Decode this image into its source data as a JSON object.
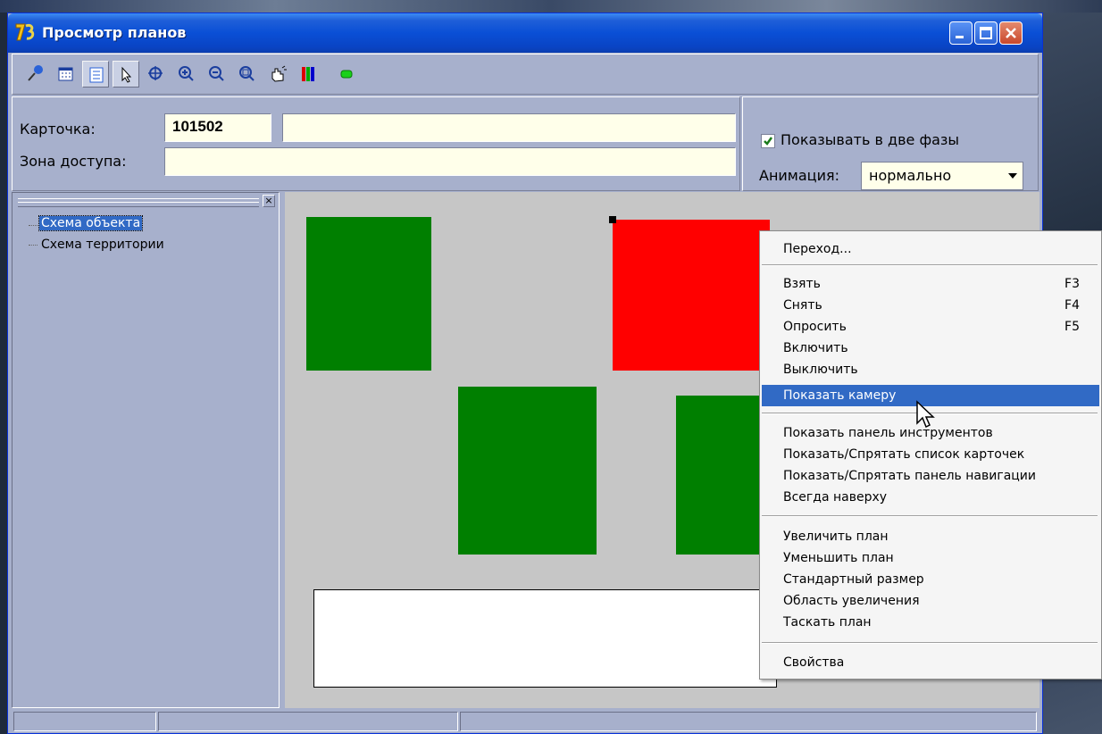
{
  "window": {
    "title": "Просмотр планов",
    "controls": [
      "minimize",
      "maximize",
      "close"
    ]
  },
  "toolbar": {
    "buttons": [
      {
        "icon": "pin-icon"
      },
      {
        "icon": "card-list-icon"
      },
      {
        "icon": "tree-panel-icon",
        "pressed": true
      },
      {
        "icon": "arrow-cursor-icon",
        "pressed": true
      },
      {
        "icon": "standard-size-icon"
      },
      {
        "icon": "zoom-in-icon"
      },
      {
        "icon": "zoom-out-icon"
      },
      {
        "icon": "zoom-area-icon"
      },
      {
        "icon": "pan-hand-icon"
      },
      {
        "icon": "colors-icon"
      },
      {
        "icon": "status-indicator-icon"
      }
    ]
  },
  "info": {
    "card_label": "Карточка:",
    "card_number": "101502",
    "card_name": "",
    "zone_label": "Зона доступа:",
    "zone_value": ""
  },
  "options": {
    "two_phase_label": "Показывать в две фазы",
    "two_phase_checked": true,
    "animation_label": "Анимация:",
    "animation_value": "нормально"
  },
  "tree": {
    "items": [
      {
        "label": "Схема объекта",
        "selected": true
      },
      {
        "label": "Схема территории",
        "selected": false
      }
    ]
  },
  "plan": {
    "colors": {
      "ok": "#007f00",
      "alarm": "#ff0000"
    },
    "zones": [
      {
        "state": "ok"
      },
      {
        "state": "alarm",
        "selected": true
      },
      {
        "state": "ok"
      },
      {
        "state": "ok"
      }
    ]
  },
  "context_menu": {
    "highlighted": "Показать камеру",
    "groups": [
      [
        {
          "label": "Переход..."
        }
      ],
      [
        {
          "label": "Взять",
          "shortcut": "F3"
        },
        {
          "label": "Снять",
          "shortcut": "F4"
        },
        {
          "label": "Опросить",
          "shortcut": "F5"
        },
        {
          "label": "Включить"
        },
        {
          "label": "Выключить"
        },
        {
          "label": "Показать камеру"
        }
      ],
      [
        {
          "label": "Показать панель инструментов"
        },
        {
          "label": "Показать/Спрятать список карточек"
        },
        {
          "label": "Показать/Спрятать панель навигации"
        },
        {
          "label": "Всегда наверху"
        }
      ],
      [
        {
          "label": "Увеличить план"
        },
        {
          "label": "Уменьшить план"
        },
        {
          "label": "Стандартный размер"
        },
        {
          "label": "Область увеличения"
        },
        {
          "label": "Таскать план"
        }
      ],
      [
        {
          "label": "Свойства"
        }
      ]
    ]
  }
}
